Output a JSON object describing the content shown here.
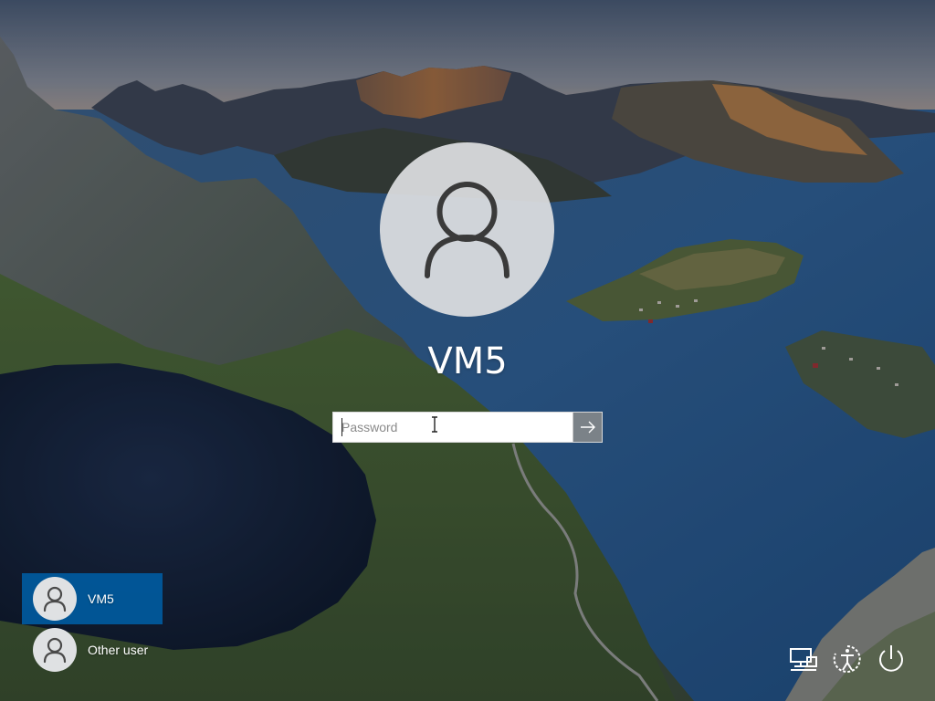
{
  "login": {
    "username": "VM5",
    "password_placeholder": "Password"
  },
  "user_list": [
    {
      "label": "VM5",
      "selected": true
    },
    {
      "label": "Other user",
      "selected": false
    }
  ],
  "icons": {
    "large_avatar": "user-icon",
    "submit": "arrow-right-icon",
    "network": "network-icon",
    "ease_of_access": "ease-of-access-icon",
    "power": "power-icon"
  },
  "colors": {
    "selected_tile": "#005a9e",
    "submit_button": "#7b8288",
    "avatar_background": "#dfe1e3",
    "text": "#ffffff"
  }
}
